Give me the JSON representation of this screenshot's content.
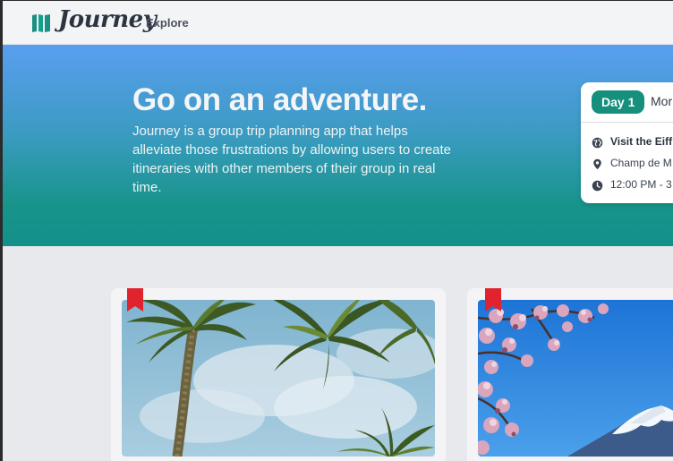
{
  "header": {
    "logo_text": "Journey",
    "nav_explore": "Explore"
  },
  "hero": {
    "title": "Go on an adventure.",
    "description": "Journey is a group trip planning app that helps alleviate those frustrations by allowing users to create itineraries with other members of their group in real time."
  },
  "itinerary": {
    "day_badge": "Day 1",
    "day_name": "Mor",
    "activity_title": "Visit the Eiff",
    "location": "Champ de M",
    "time": "12:00 PM - 3"
  },
  "colors": {
    "brand_teal": "#168f7d",
    "bookmark_red": "#e0232e",
    "hero_top": "#5a9ef0",
    "hero_bottom": "#13908a"
  },
  "icons": [
    "globe-icon",
    "map-pin-icon",
    "clock-icon",
    "bookmark-icon"
  ],
  "trips": [
    {
      "image": "palm-trees-sky",
      "bookmarked": true
    },
    {
      "image": "mount-fuji-cherry-blossoms",
      "bookmarked": true
    }
  ]
}
